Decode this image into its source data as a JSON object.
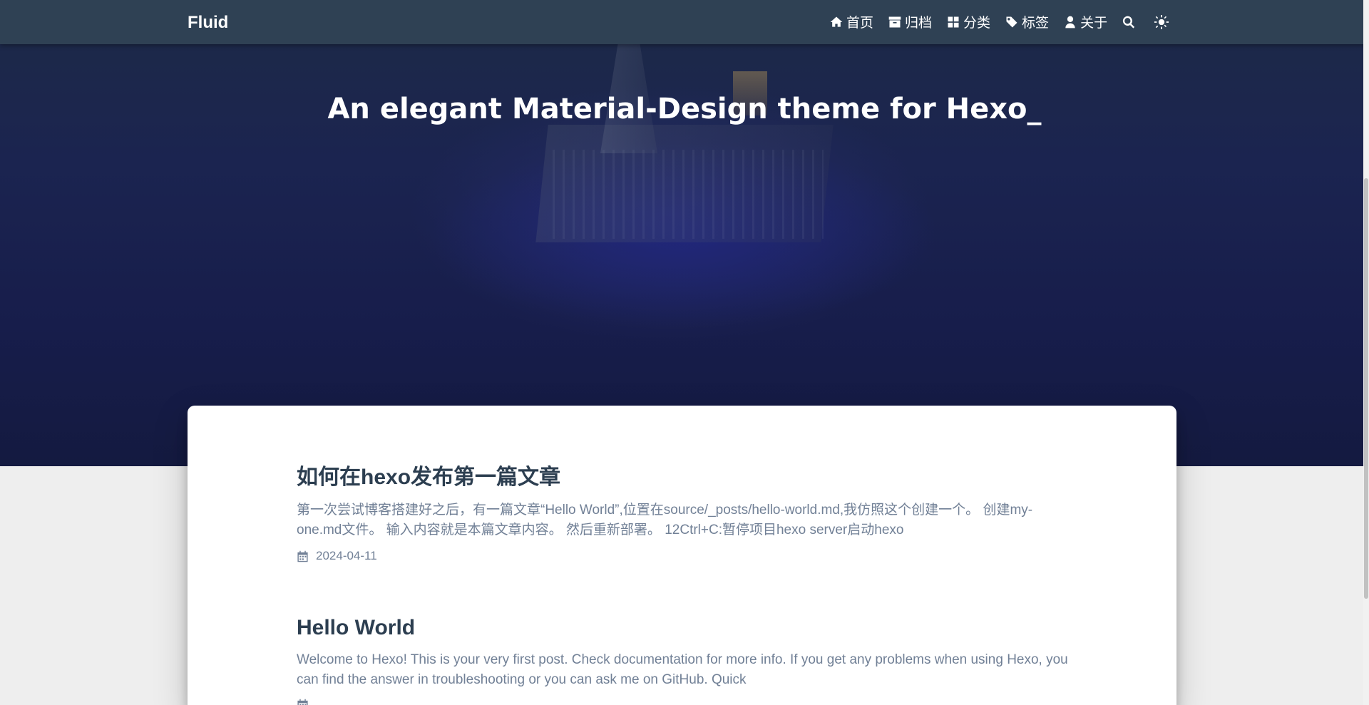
{
  "navbar": {
    "brand": "Fluid",
    "items": [
      {
        "label": "首页",
        "icon": "home-icon"
      },
      {
        "label": "归档",
        "icon": "archive-icon"
      },
      {
        "label": "分类",
        "icon": "category-icon"
      },
      {
        "label": "标签",
        "icon": "tag-icon"
      },
      {
        "label": "关于",
        "icon": "user-icon"
      }
    ],
    "search_icon": "search-icon",
    "theme_icon": "sun-icon"
  },
  "banner": {
    "title": "An elegant Material-Design theme for Hexo_"
  },
  "posts": [
    {
      "title": "如何在hexo发布第一篇文章",
      "excerpt": "第一次尝试博客搭建好之后，有一篇文章“Hello World”,位置在source/_posts/hello-world.md,我仿照这个创建一个。 创建my-one.md文件。 输入内容就是本篇文章内容。 然后重新部署。 12Ctrl+C:暂停项目hexo server启动hexo",
      "date": "2024-04-11",
      "date_icon": "calendar-icon"
    },
    {
      "title": "Hello World",
      "excerpt": "Welcome to Hexo! This is your very first post. Check documentation for more info. If you get any problems when using Hexo, you can find the answer in troubleshooting or you can ask me on GitHub. Quick",
      "date": "",
      "date_icon": "calendar-icon"
    }
  ]
}
